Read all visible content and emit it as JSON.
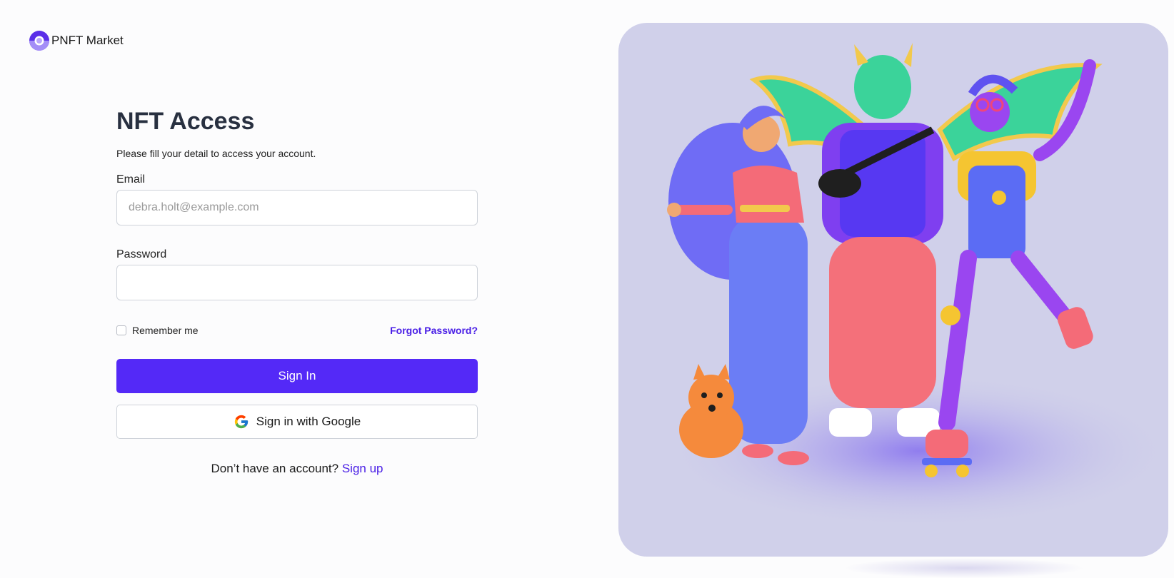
{
  "app": {
    "name": "PNFT Market",
    "logo_icon": "nft-logo-icon"
  },
  "form": {
    "title": "NFT Access",
    "subtitle": "Please fill your detail to access your account.",
    "email_label": "Email",
    "email_placeholder": "debra.holt@example.com",
    "email_value": "",
    "password_label": "Password",
    "password_value": "",
    "remember_label": "Remember me",
    "remember_checked": false,
    "forgot_label": "Forgot Password?",
    "signin_label": "Sign In",
    "google_label": "Sign in with Google",
    "google_icon": "google-icon",
    "signup_prompt": "Don’t have an account?",
    "signup_link": "Sign up"
  },
  "hero": {
    "image": "3d-characters-illustration"
  },
  "colors": {
    "accent": "#5429f7",
    "link": "#4a1fe6",
    "title": "#283040",
    "hero_bg": "#d0d0ea"
  }
}
